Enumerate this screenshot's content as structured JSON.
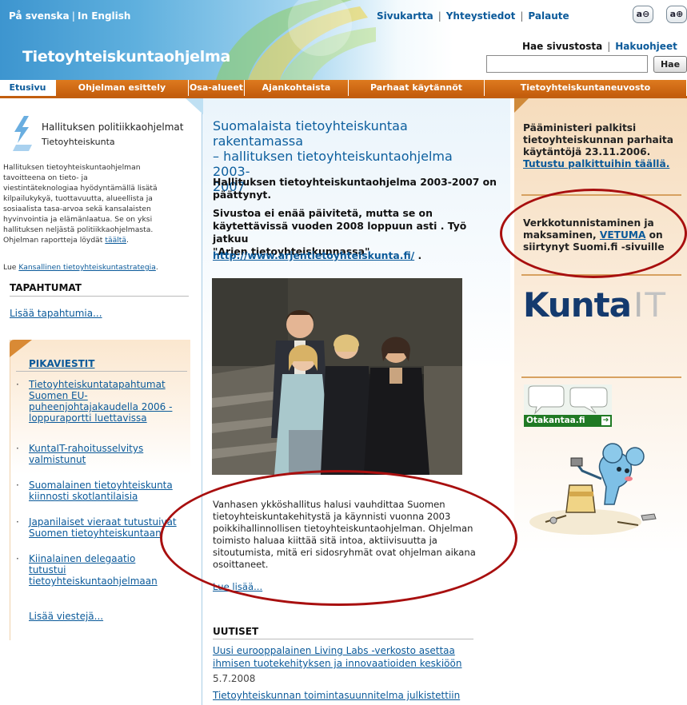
{
  "header": {
    "lang_sv": "På svenska",
    "lang_en": "In English",
    "site_title": "Tietoyhteiskuntaohjelma",
    "toplinks": [
      "Sivukartta",
      "Yhteystiedot",
      "Palaute"
    ],
    "zoom_out": "a⊖",
    "zoom_in": "a⊕",
    "search_label": "Hae sivustosta",
    "search_advanced": "Hakuohjeet",
    "search_placeholder": "",
    "search_button": "Hae"
  },
  "nav": [
    "Etusivu",
    "Ohjelman esittely",
    "Osa-alueet",
    "Ajankohtaista",
    "Parhaat käytännöt",
    "Tietoyhteiskuntaneuvosto"
  ],
  "left": {
    "logo_line1": "Hallituksen politiikkaohjelmat",
    "logo_line2": "Tietoyhteiskunta",
    "desc_lines": [
      "Hallituksen tietoyhteiskuntaohjelman",
      "tavoitteena on tieto- ja",
      "viestintäteknologiaa hyödyntämällä lisätä",
      "kilpailukykyä, tuottavuutta, alueellista ja",
      "sosiaalista tasa-arvoa sekä kansalaisten",
      "hyvinvointia ja elämänlaatua. Se on yksi",
      "hallituksen neljästä politiikkaohjelmasta.",
      "Ohjelman raportteja löydät"
    ],
    "desc_link": "täältä",
    "strategy_prefix": "Lue",
    "strategy_link": "Kansallinen tietoyhteiskuntastrategia",
    "events_title": "TAPAHTUMAT",
    "events_more": "Lisää tapahtumia...",
    "flash_title": "PIKAVIESTIT",
    "flash_items": [
      [
        "Tietoyhteiskuntatapahtumat",
        "Suomen EU-",
        "puheenjohtajakaudella 2006 -",
        "loppuraportti luettavissa"
      ],
      [
        "KuntaIT-rahoitusselvitys",
        "valmistunut"
      ],
      [
        "Suomalainen tietoyhteiskunta",
        "kiinnosti skotlantilaisia"
      ],
      [
        "Japanilaiset vieraat tutustuivat",
        "Suomen tietoyhteiskuntaan"
      ],
      [
        "Kiinalainen delegaatio",
        "tutustui",
        "tietoyhteiskuntaohjelmaan"
      ]
    ],
    "flash_more": "Lisää viestejä..."
  },
  "center": {
    "title_lines": [
      "Suomalaista tietoyhteiskuntaa rakentamassa",
      "– hallituksen tietoyhteiskuntaohjelma 2003-",
      "2007"
    ],
    "intro1_lines": [
      "Hallituksen tietoyhteiskuntaohjelma 2003-2007 on",
      "päättynyt."
    ],
    "intro2_lines": [
      "Sivustoa ei enää päivitetä, mutta se on",
      "käytettävissä vuoden 2008 loppuun asti . Työ jatkuu",
      "\"Arjen tietoyhteiskunnassa\""
    ],
    "url": "http://www.arjentietoyhteiskunta.fi/",
    "url_suffix": " .",
    "body_lines": [
      "Vanhasen ykköshallitus halusi vauhdittaa Suomen",
      "tietoyhteiskuntakehitystä ja käynnisti vuonna 2003",
      "poikkihallinnollisen tietoyhteiskuntaohjelman. Ohjelman",
      "toimisto haluaa kiittää sitä intoa, aktiivisuutta ja",
      "sitoutumista, mitä eri sidosryhmät ovat ohjelman aikana",
      "osoittaneet."
    ],
    "read_more": "Lue lisää...",
    "news_title": "UUTISET",
    "news": [
      {
        "lines": [
          "Uusi eurooppalainen Living Labs -verkosto asettaa",
          "ihmisen tuotekehityksen ja innovaatioiden keskiöön"
        ],
        "date": "5.7.2008"
      },
      {
        "lines": [
          "Tietoyhteiskunnan toimintasuunnitelma julkistettiin"
        ],
        "date": ""
      }
    ]
  },
  "right": {
    "award_lines": [
      "Pääministeri palkitsi",
      "tietoyhteiskunnan parhaita",
      "käytäntöjä 23.11.2006."
    ],
    "award_link": "Tutustu palkittuihin täällä.",
    "vetuma_line1": "Verkkotunnistaminen ja",
    "vetuma_pre": "maksaminen, ",
    "vetuma_link": "VETUMA",
    "vetuma_post": " on",
    "vetuma_line3": "siirtynyt Suomi.fi -sivuille",
    "kunta": "Kunta",
    "it_i": "I",
    "it_t": "T",
    "otakantaa": "Otakantaa.fi"
  },
  "colors": {
    "nav_orange": "#c45d0c",
    "link_blue": "#0b5a9a",
    "annotation_red": "#a80f0f",
    "header_blue": "#3d95cf"
  }
}
